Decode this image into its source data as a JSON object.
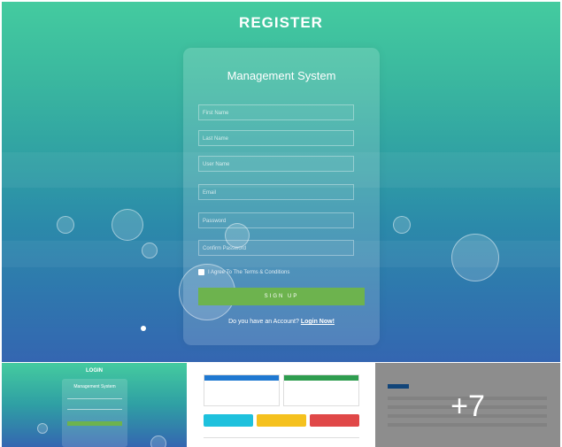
{
  "page": {
    "title": "REGISTER",
    "card_title": "Management System"
  },
  "form": {
    "fields": [
      {
        "placeholder": "First Name"
      },
      {
        "placeholder": "Last Name"
      },
      {
        "placeholder": "User Name"
      },
      {
        "placeholder": "Email"
      },
      {
        "placeholder": "Password"
      },
      {
        "placeholder": "Confirm Password"
      }
    ],
    "agree_label": "I Agree To The Terms & Conditions",
    "signup_label": "SIGN UP",
    "account_prompt": "Do you have an Account?",
    "login_link": "Login Now!"
  },
  "thumbnails": {
    "login_title": "LOGIN",
    "login_card_title": "Management System",
    "more_count": "+7"
  },
  "colors": {
    "gradient_top": "#44cb9f",
    "gradient_bottom": "#3466b1",
    "signup_button": "#6db34e"
  }
}
